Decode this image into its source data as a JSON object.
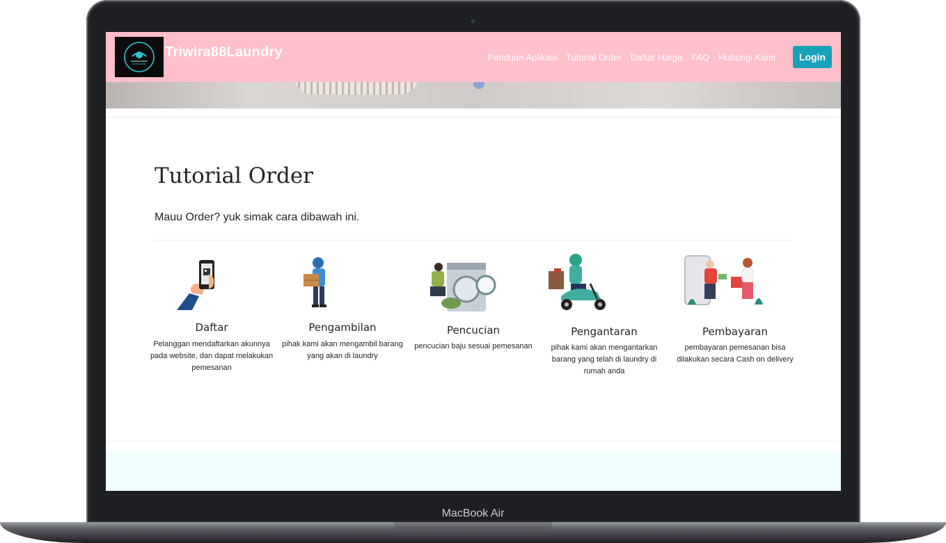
{
  "device": {
    "label": "MacBook Air"
  },
  "navbar": {
    "brand": "Triwira88Laundry",
    "links": [
      "Panduan Aplikasi",
      "Tutorial Order",
      "Daftar Harga",
      "FAQ",
      "Hubungi Kami"
    ],
    "login_label": "Login"
  },
  "main": {
    "title": "Tutorial Order",
    "subtitle": "Mauu Order? yuk simak cara dibawah ini.",
    "steps": [
      {
        "name": "Daftar",
        "desc": "Pelanggan mendaftarkan akunnya pada website, dan dapat melakukan pemesanan"
      },
      {
        "name": "Pengambilan",
        "desc": "pihak kami akan mengambil barang yang akan di laundry"
      },
      {
        "name": "Pencucian",
        "desc": "pencucian baju sesuai pemesanan"
      },
      {
        "name": "Pengantaran",
        "desc": "pihak kami akan mengantarkan barang yang telah di laundry di rumah anda"
      },
      {
        "name": "Pembayaran",
        "desc": "pembayaran pemesanan bisa dilakukan secara Cash on delivery"
      }
    ]
  },
  "colors": {
    "navbar_bg": "#ffbfcb",
    "login_bg": "#17a2b8",
    "footer_band": "#f0fdfd"
  },
  "icons": [
    "laundry-logo-icon",
    "phone-qr-illustration",
    "delivery-man-box-illustration",
    "washing-machine-illustration",
    "scooter-courier-illustration",
    "cash-payment-illustration"
  ]
}
